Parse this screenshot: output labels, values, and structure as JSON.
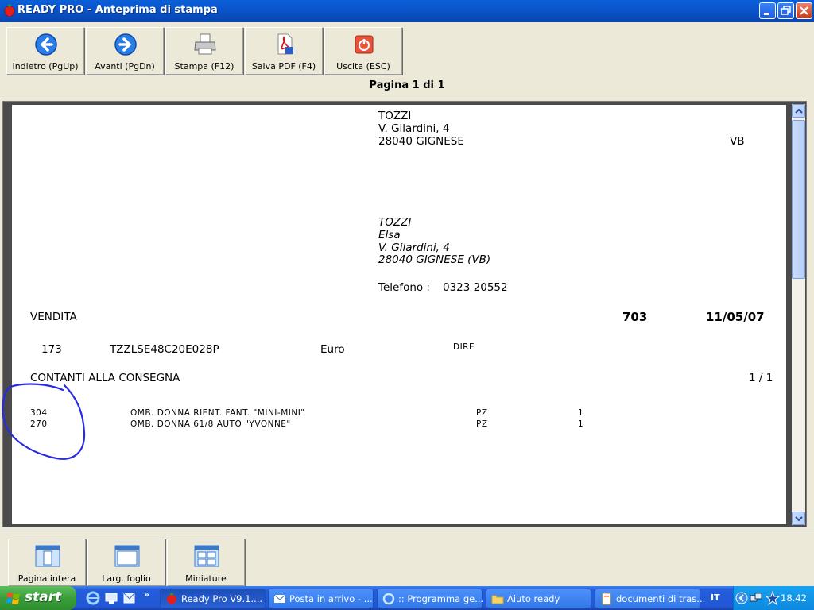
{
  "window": {
    "title": "READY PRO - Anteprima di stampa",
    "minimize": "Minimize",
    "maximize": "Maximize",
    "close": "Close"
  },
  "toolbar": {
    "back_label": "Indietro (PgUp)",
    "forward_label": "Avanti (PgDn)",
    "print_label": "Stampa (F12)",
    "pdf_label": "Salva PDF (F4)",
    "exit_label": "Uscita (ESC)"
  },
  "page_info": "Pagina 1 di 1",
  "document": {
    "recipient": {
      "name": "TOZZI",
      "street": "V. Gilardini, 4",
      "city": "28040  GIGNESE",
      "province": "VB"
    },
    "destination": {
      "name": "TOZZI",
      "first_name": "Elsa",
      "street": "V. Gilardini, 4",
      "city": "28040 GIGNESE (VB)",
      "phone_label": "Telefono :",
      "phone": "0323 20552"
    },
    "doc_type": "VENDITA",
    "doc_number": "703",
    "doc_date": "11/05/07",
    "customer_code": "173",
    "tax_code": "TZZLSE48C20E028P",
    "currency": "Euro",
    "transport": "DIRE",
    "payment": "CONTANTI ALLA CONSEGNA",
    "page": "1 / 1",
    "lines": [
      {
        "code": "304",
        "description": "OMB. DONNA RIENT. FANT. \"MINI-MINI\"",
        "unit": "PZ",
        "qty": "1"
      },
      {
        "code": "270",
        "description": "OMB. DONNA 61/8 AUTO \"YVONNE\"",
        "unit": "PZ",
        "qty": "1"
      }
    ]
  },
  "bottom_toolbar": {
    "full_page_label": "Pagina intera",
    "page_width_label": "Larg. foglio",
    "thumbnails_label": "Miniature"
  },
  "taskbar": {
    "start_label": "start",
    "tasks": [
      {
        "label": "Ready Pro V9.1...."
      },
      {
        "label": "Posta in arrivo - ..."
      },
      {
        "label": ":: Programma ge..."
      },
      {
        "label": "Aiuto ready"
      },
      {
        "label": "documenti di tras..."
      }
    ],
    "language": "IT",
    "clock": "18.42"
  },
  "colors": {
    "title_bar": "#0a55cc",
    "annotation_circle": "#2a2ae0",
    "taskbar": "#245edb",
    "start_button": "#3a9d3a"
  }
}
